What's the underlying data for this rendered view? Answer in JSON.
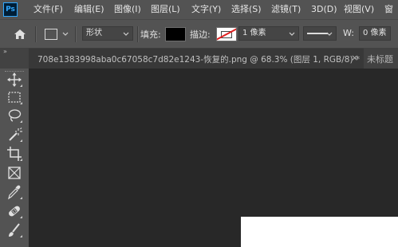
{
  "app": {
    "logo": "Ps"
  },
  "menu": [
    {
      "label": "文件(F)"
    },
    {
      "label": "编辑(E)"
    },
    {
      "label": "图像(I)"
    },
    {
      "label": "图层(L)"
    },
    {
      "label": "文字(Y)"
    },
    {
      "label": "选择(S)"
    },
    {
      "label": "滤镜(T)"
    },
    {
      "label": "3D(D)"
    },
    {
      "label": "视图(V)"
    },
    {
      "label": "窗"
    }
  ],
  "options": {
    "mode_value": "形状",
    "fill_label": "填充:",
    "fill_color": "#000000",
    "stroke_label": "描边:",
    "stroke_color": "none",
    "stroke_width_value": "1 像素",
    "width_label": "W:",
    "width_value": "0 像素"
  },
  "tabs": {
    "active_title": "708e1383998aba0c67058c7d82e1243-恢复的.png @ 68.3% (图层 1, RGB/8) *",
    "close_glyph": "×",
    "next_title": "未标题"
  },
  "toolbar": {
    "collapse_glyph": "»",
    "tools": [
      {
        "name": "move-tool-icon"
      },
      {
        "name": "marquee-tool-icon"
      },
      {
        "name": "lasso-tool-icon"
      },
      {
        "name": "magic-wand-tool-icon"
      },
      {
        "name": "crop-tool-icon"
      },
      {
        "name": "frame-tool-icon"
      },
      {
        "name": "eyedropper-tool-icon"
      },
      {
        "name": "healing-brush-tool-icon"
      },
      {
        "name": "brush-tool-icon"
      }
    ]
  },
  "colors": {
    "chrome": "#535353",
    "canvas_bg": "#282828",
    "document": "#ffffff",
    "accent_blue": "#31a8ff"
  }
}
